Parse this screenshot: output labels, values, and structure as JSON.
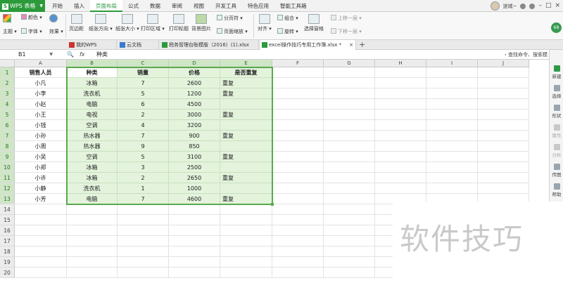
{
  "app": {
    "name": "WPS 表格"
  },
  "menu": [
    "开始",
    "插入",
    "页面布局",
    "公式",
    "数据",
    "审阅",
    "视图",
    "开发工具",
    "特色应用",
    "智能工具箱"
  ],
  "menu_active_index": 2,
  "user": {
    "name": "迷城~"
  },
  "ribbon": {
    "theme": "主题",
    "colors": "颜色",
    "fonts": "字体",
    "effects": "效果",
    "margins": "页边距",
    "orientation": "纸张方向",
    "size": "纸张大小",
    "print_area": "打印区域",
    "print_titles": "打印标题",
    "background": "背景图片",
    "page_break": "分页符",
    "page_zoom": "页面缩放",
    "align": "对齐",
    "group": "组合",
    "rotate": "旋转",
    "selection_pane": "选择窗格",
    "bring_forward": "上移一层",
    "send_backward": "下移一层",
    "badge": "68"
  },
  "tabs": [
    {
      "label": "我的WPS"
    },
    {
      "label": "云文档"
    },
    {
      "label": "税务管理台账模版（2016）(1).xlsx"
    },
    {
      "label": "excel操作技巧专用工作簿.xlsx *"
    }
  ],
  "formula_bar": {
    "cell_ref": "B1",
    "fx": "fx",
    "content": "种类",
    "search": "查找命令、搜索模"
  },
  "columns": [
    "A",
    "B",
    "C",
    "D",
    "E",
    "F",
    "G",
    "H",
    "I",
    "J"
  ],
  "rows": [
    "1",
    "2",
    "3",
    "4",
    "5",
    "6",
    "7",
    "8",
    "9",
    "10",
    "11",
    "12",
    "13",
    "14",
    "15",
    "16",
    "17",
    "18",
    "19",
    "20"
  ],
  "sheet": {
    "headers": [
      "销售人员",
      "种类",
      "销量",
      "价格",
      "是否重复"
    ],
    "data": [
      [
        "小凡",
        "冰箱",
        "7",
        "2600",
        "重复"
      ],
      [
        "小李",
        "洗衣机",
        "5",
        "1200",
        "重复"
      ],
      [
        "小赵",
        "电脑",
        "6",
        "4500",
        ""
      ],
      [
        "小王",
        "电视",
        "2",
        "3000",
        "重复"
      ],
      [
        "小钱",
        "空调",
        "4",
        "3200",
        ""
      ],
      [
        "小孙",
        "热水器",
        "7",
        "900",
        "重复"
      ],
      [
        "小周",
        "热水器",
        "9",
        "850",
        ""
      ],
      [
        "小吴",
        "空调",
        "5",
        "3100",
        "重复"
      ],
      [
        "小郑",
        "冰箱",
        "3",
        "2500",
        ""
      ],
      [
        "小许",
        "冰箱",
        "2",
        "2650",
        "重复"
      ],
      [
        "小静",
        "洗衣机",
        "1",
        "1000",
        ""
      ],
      [
        "小芳",
        "电脑",
        "7",
        "4600",
        "重复"
      ]
    ]
  },
  "side_panel": [
    "新建",
    "选择",
    "形状",
    "属性",
    "分析",
    "传图",
    "帮助"
  ],
  "watermark": "软件技巧"
}
